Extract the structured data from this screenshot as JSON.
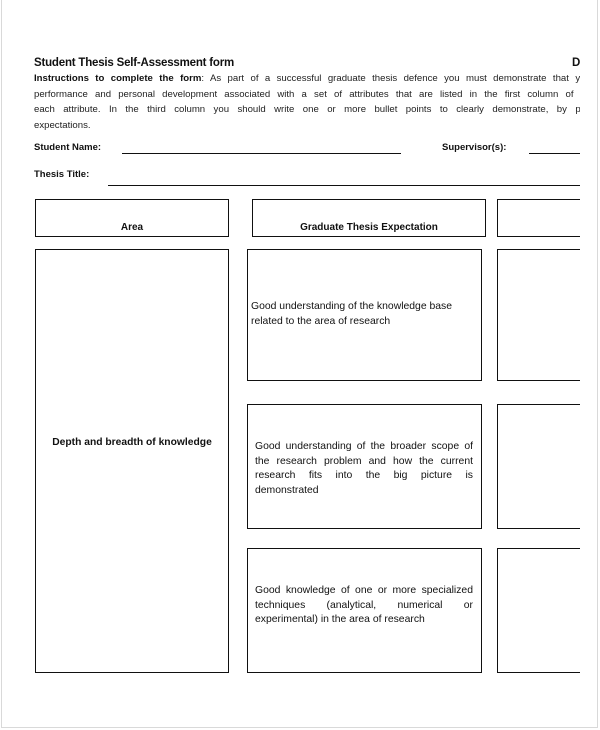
{
  "document": {
    "title": "Student Thesis Self-Assessment form",
    "title_right_fragment": "D",
    "instructions": {
      "lead": "Instructions to complete the form",
      "line1_rest": ": As part of a successful graduate thesis defence you must demonstrate that your",
      "line2": "performance and personal development associated with a set of attributes that are listed in the first column of the",
      "line3": "each attribute. In the third column you should write one or more bullet points to clearly demonstrate, by prov",
      "line4": "expectations."
    },
    "fields": {
      "student_name_label": "Student Name:",
      "supervisor_label": "Supervisor(s):",
      "thesis_title_label": "Thesis Title:"
    },
    "table": {
      "headers": [
        "Area",
        "Graduate Thesis Expectation",
        ""
      ],
      "area": "Depth and breadth of knowledge",
      "expectations": [
        "Good understanding of the knowledge base related to the area of research",
        "Good understanding of the broader scope of the research problem and how the current research fits into the big picture is demonstrated",
        "Good knowledge of one or more specialized techniques (analytical, numerical or experimental) in the area of research"
      ]
    }
  }
}
